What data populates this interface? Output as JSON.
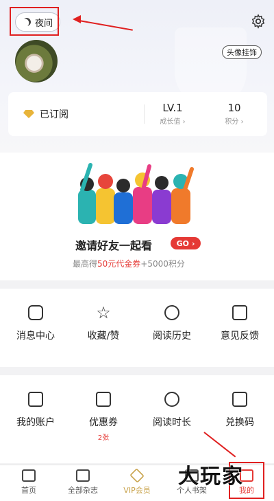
{
  "header": {
    "night_mode_label": "夜间",
    "avatar_frame_label": "头像挂饰"
  },
  "stats": {
    "subscribed_label": "已订阅",
    "level_value": "LV.1",
    "level_label": "成长值",
    "points_value": "10",
    "points_label": "积分"
  },
  "invite": {
    "title": "邀请好友一起看",
    "go_label": "GO",
    "subtitle_prefix": "最高得",
    "subtitle_highlight": "50元代金券",
    "subtitle_suffix": "+5000积分"
  },
  "grid1": [
    {
      "label": "消息中心",
      "icon": "message-icon"
    },
    {
      "label": "收藏/赞",
      "icon": "star-icon"
    },
    {
      "label": "阅读历史",
      "icon": "history-icon"
    },
    {
      "label": "意见反馈",
      "icon": "feedback-icon"
    }
  ],
  "grid2": [
    {
      "label": "我的账户",
      "icon": "wallet-icon",
      "sub": ""
    },
    {
      "label": "优惠券",
      "icon": "coupon-icon",
      "sub": "2张"
    },
    {
      "label": "阅读时长",
      "icon": "clock-icon",
      "sub": ""
    },
    {
      "label": "兑换码",
      "icon": "barcode-icon",
      "sub": ""
    }
  ],
  "tabbar": [
    {
      "label": "首页",
      "icon": "home-icon"
    },
    {
      "label": "全部杂志",
      "icon": "book-icon"
    },
    {
      "label": "VIP会员",
      "icon": "vip-icon"
    },
    {
      "label": "个人书架",
      "icon": "shelf-icon"
    },
    {
      "label": "我的",
      "icon": "me-icon"
    }
  ],
  "watermark": "大玩家",
  "colors": {
    "accent": "#e53935",
    "vip": "#c8a24a",
    "annotation": "#e02020"
  }
}
